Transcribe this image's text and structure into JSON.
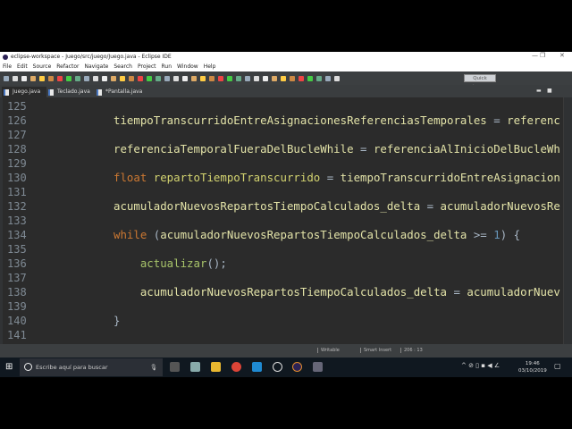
{
  "window": {
    "title": "eclipse-workspace - Juego/src/juego/Juego.java - Eclipse IDE",
    "minimize": "—",
    "restore": "❐",
    "close": "✕"
  },
  "menu": [
    "File",
    "Edit",
    "Source",
    "Refactor",
    "Navigate",
    "Search",
    "Project",
    "Run",
    "Window",
    "Help"
  ],
  "toolbar": {
    "quick_access": "Quick Access"
  },
  "tabs": [
    {
      "label": "Juego.java",
      "close": "✕"
    },
    {
      "label": "Teclado.java"
    },
    {
      "label": "*Pantalla.java"
    }
  ],
  "editor": {
    "line_numbers": [
      "125",
      "126",
      "127",
      "128",
      "129",
      "130",
      "131",
      "132",
      "133",
      "134",
      "135",
      "136",
      "137",
      "138",
      "139",
      "140",
      "141"
    ],
    "lines": [
      [],
      [
        [
          "f",
          "tiempoTranscurridoEntreAsignacionesReferenciasTemporales"
        ],
        [
          "t",
          " = "
        ],
        [
          "f",
          "referenc"
        ]
      ],
      [],
      [
        [
          "f",
          "referenciaTemporalFueraDelBucleWhile"
        ],
        [
          "t",
          " = "
        ],
        [
          "f",
          "referenciaAlInicioDelBucleWh"
        ]
      ],
      [],
      [
        [
          "k",
          "float "
        ],
        [
          "v",
          "repartoTiempoTranscurrido"
        ],
        [
          "t",
          " = "
        ],
        [
          "f",
          "tiempoTranscurridoEntreAsignacion"
        ]
      ],
      [],
      [
        [
          "f",
          "acumuladorNuevosRepartosTiempoCalculados_delta"
        ],
        [
          "t",
          " = "
        ],
        [
          "f",
          "acumuladorNuevosRe"
        ]
      ],
      [],
      [
        [
          "k",
          "while"
        ],
        [
          "t",
          " ("
        ],
        [
          "f",
          "acumuladorNuevosRepartosTiempoCalculados_delta"
        ],
        [
          "t",
          " >= "
        ],
        [
          "n",
          "1"
        ],
        [
          "t",
          ") {"
        ]
      ],
      [],
      [
        [
          "t",
          "    "
        ],
        [
          "m",
          "actualizar"
        ],
        [
          "t",
          "();"
        ]
      ],
      [],
      [
        [
          "t",
          "    "
        ],
        [
          "f",
          "acumuladorNuevosRepartosTiempoCalculados_delta"
        ],
        [
          "t",
          " = "
        ],
        [
          "f",
          "acumuladorNuev"
        ]
      ],
      [],
      [
        [
          "t",
          "}"
        ]
      ],
      []
    ]
  },
  "colors": {
    "f": "#e3e3a8",
    "t": "#a9b7c6",
    "k": "#cc7832",
    "v": "#d4d470",
    "m": "#a8c46a",
    "n": "#6897bb"
  },
  "status": {
    "mode": "Writable",
    "insert": "Smart Insert",
    "position": "206 : 13"
  },
  "taskbar": {
    "search_placeholder": "Escribe aquí para buscar",
    "time": "19:46",
    "date": "03/10/2019"
  }
}
